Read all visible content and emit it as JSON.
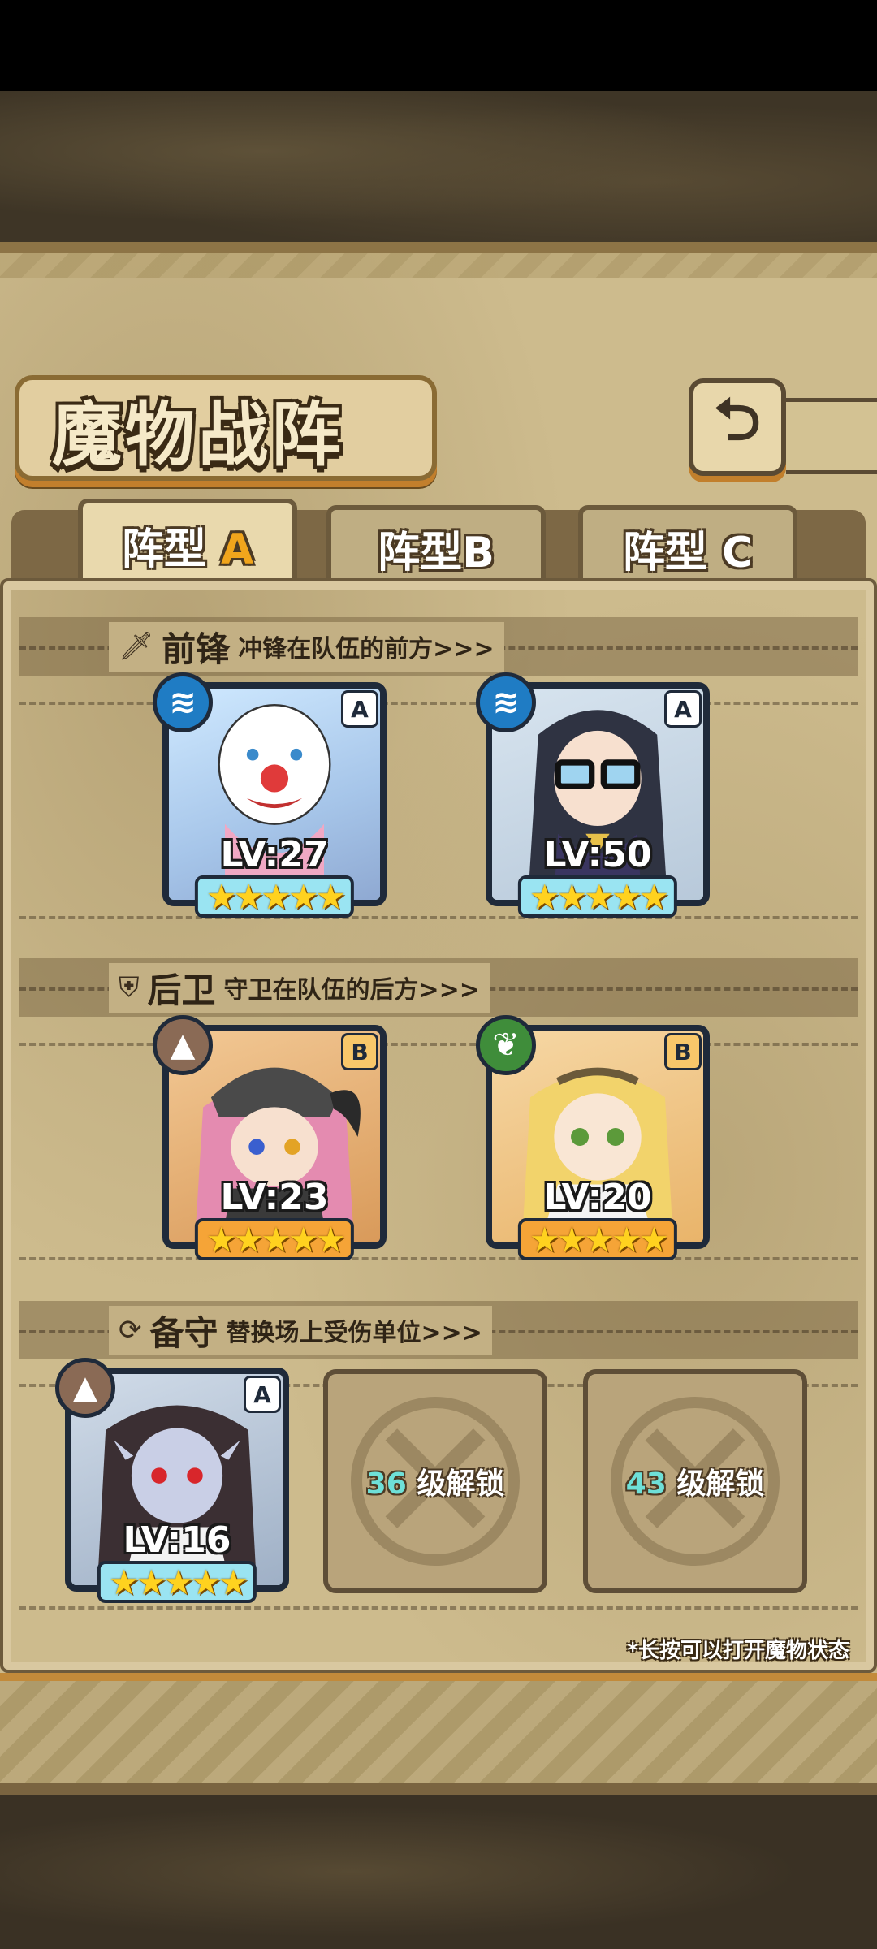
{
  "header": {
    "title": "魔物战阵",
    "back_icon": "⮌"
  },
  "tabs": [
    {
      "prefix": "阵型",
      "letter": "A",
      "active": true
    },
    {
      "prefix": "阵型",
      "letter": "B",
      "active": false
    },
    {
      "prefix": "阵型",
      "letter": "C",
      "active": false
    }
  ],
  "sections": {
    "front": {
      "icon": "sword-icon",
      "title": "前锋",
      "desc": "冲锋在队伍的前方>>>"
    },
    "rear": {
      "icon": "shield-icon",
      "title": "后卫",
      "desc": "守卫在队伍的后方>>>"
    },
    "reserve": {
      "icon": "swap-icon",
      "title": "备守",
      "desc": "替换场上受伤单位>>>"
    }
  },
  "units": {
    "front": [
      {
        "level": "LV:27",
        "rank": "A",
        "element": "water",
        "stars": "★★★★★",
        "portrait": "clown-monster"
      },
      {
        "level": "LV:50",
        "rank": "A",
        "element": "water",
        "stars": "★★★★★",
        "portrait": "glasses-girl"
      }
    ],
    "rear": [
      {
        "level": "LV:23",
        "rank": "B",
        "element": "earth",
        "stars": "★★★★★",
        "portrait": "horned-knight"
      },
      {
        "level": "LV:20",
        "rank": "B",
        "element": "leaf",
        "stars": "★★★★★",
        "portrait": "blonde-elf"
      }
    ],
    "reserve": [
      {
        "level": "LV:16",
        "rank": "A",
        "element": "earth",
        "stars": "★★★★★",
        "portrait": "vampire-girl"
      }
    ]
  },
  "locked_slots": [
    {
      "level": "36",
      "suffix": "级解锁"
    },
    {
      "level": "43",
      "suffix": "级解锁"
    }
  ],
  "hint": "*长按可以打开魔物状态",
  "colors": {
    "rank_a": "#9ae4f2",
    "rank_b": "#f5a437",
    "panel": "#cdbb8d"
  }
}
